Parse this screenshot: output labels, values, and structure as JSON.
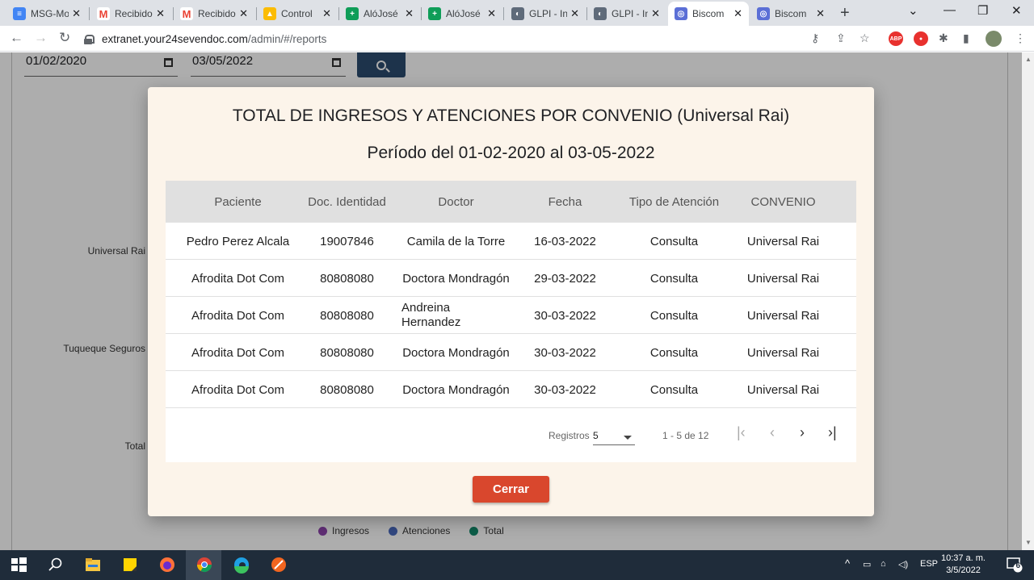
{
  "browser": {
    "tabs": [
      {
        "title": "MSG-Mo",
        "icon": "docs-icon",
        "color": "#4285f4"
      },
      {
        "title": "Recibido",
        "icon": "gmail-icon",
        "color": "#ea4335"
      },
      {
        "title": "Recibido",
        "icon": "gmail-icon",
        "color": "#ea4335"
      },
      {
        "title": "Control",
        "icon": "drive-icon",
        "color": "#fbbc04"
      },
      {
        "title": "AlóJosé",
        "icon": "sheets-icon",
        "color": "#0f9d58"
      },
      {
        "title": "AlóJosé",
        "icon": "sheets-icon",
        "color": "#0f9d58"
      },
      {
        "title": "GLPI - In",
        "icon": "glpi-icon",
        "color": "#5f6b7a"
      },
      {
        "title": "GLPI - In",
        "icon": "glpi-icon",
        "color": "#5f6b7a"
      },
      {
        "title": "Biscom",
        "icon": "biscom-icon",
        "color": "#5b6fd6"
      },
      {
        "title": "Biscom",
        "icon": "biscom-icon",
        "color": "#5b6fd6"
      }
    ],
    "url_host": "extranet.your24sevendoc.com",
    "url_path": "/admin/#/reports"
  },
  "filters": {
    "date_from": "01/02/2020",
    "date_to": "03/05/2022"
  },
  "background": {
    "labels": [
      "Universal Rai",
      "Tuqueque Seguros",
      "Total"
    ],
    "legend": [
      {
        "label": "Ingresos",
        "color": "#8e44ad"
      },
      {
        "label": "Atenciones",
        "color": "#4a6bbf"
      },
      {
        "label": "Total",
        "color": "#138a6b"
      }
    ]
  },
  "modal": {
    "title": "TOTAL DE INGRESOS Y ATENCIONES POR CONVENIO (Universal Rai)",
    "subtitle": "Período del 01-02-2020 al 03-05-2022",
    "columns": [
      "Paciente",
      "Doc. Identidad",
      "Doctor",
      "Fecha",
      "Tipo de Atención",
      "CONVENIO"
    ],
    "rows": [
      [
        "Pedro Perez Alcala",
        "19007846",
        "Camila de la Torre",
        "16-03-2022",
        "Consulta",
        "Universal Rai"
      ],
      [
        "Afrodita Dot Com",
        "80808080",
        "Doctora Mondragón",
        "29-03-2022",
        "Consulta",
        "Universal Rai"
      ],
      [
        "Afrodita Dot Com",
        "80808080",
        "Andreina Hernandez",
        "30-03-2022",
        "Consulta",
        "Universal Rai"
      ],
      [
        "Afrodita Dot Com",
        "80808080",
        "Doctora Mondragón",
        "30-03-2022",
        "Consulta",
        "Universal Rai"
      ],
      [
        "Afrodita Dot Com",
        "80808080",
        "Doctora Mondragón",
        "30-03-2022",
        "Consulta",
        "Universal Rai"
      ]
    ],
    "pager": {
      "label": "Registros",
      "page_size": "5",
      "range": "1 - 5 de 12"
    },
    "close_label": "Cerrar"
  },
  "taskbar": {
    "language": "ESP",
    "time": "10:37 a. m.",
    "date": "3/5/2022",
    "notifications": "6"
  }
}
